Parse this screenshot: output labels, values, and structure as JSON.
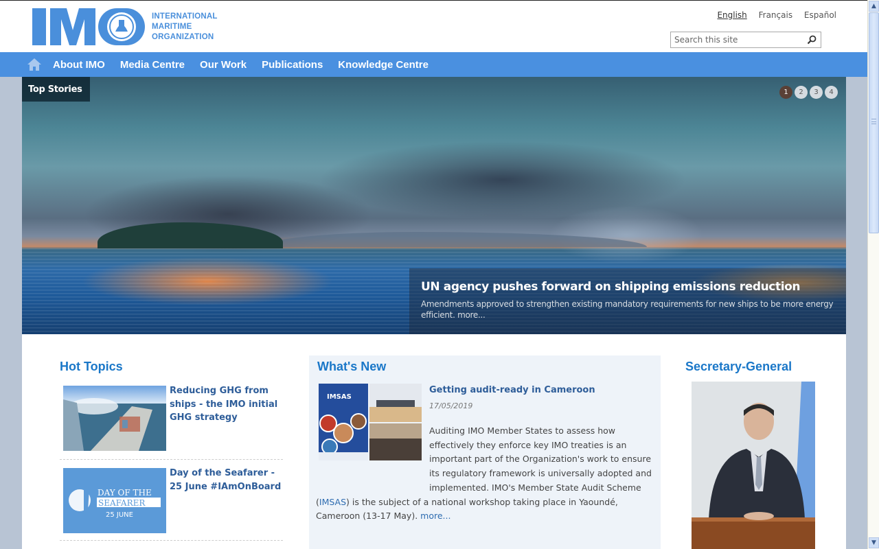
{
  "header": {
    "logo_text": "IMO",
    "org_name_lines": [
      "INTERNATIONAL",
      "MARITIME",
      "ORGANIZATION"
    ],
    "languages": [
      {
        "label": "English",
        "active": true
      },
      {
        "label": "Français",
        "active": false
      },
      {
        "label": "Español",
        "active": false
      }
    ],
    "search": {
      "placeholder": "Search this site",
      "value": "",
      "icon": "search-icon"
    },
    "brand_color": "#4a90e0"
  },
  "nav": {
    "home_icon": "home-icon",
    "items": [
      {
        "label": "About IMO"
      },
      {
        "label": "Media Centre"
      },
      {
        "label": "Our Work"
      },
      {
        "label": "Publications"
      },
      {
        "label": "Knowledge Centre"
      }
    ]
  },
  "hero": {
    "label": "Top Stories",
    "pager": [
      {
        "label": "1",
        "active": true
      },
      {
        "label": "2",
        "active": false
      },
      {
        "label": "3",
        "active": false
      },
      {
        "label": "4",
        "active": false
      }
    ],
    "title": "UN agency pushes forward on shipping emissions reduction",
    "description": "Amendments approved to strengthen existing mandatory requirements for new ships to be more energy efficient.",
    "more": "more..."
  },
  "hot_topics": {
    "title": "Hot Topics",
    "items": [
      {
        "title": "Reducing GHG from ships - the IMO initial GHG strategy",
        "image": "container-ship-photo"
      },
      {
        "title": "Day of the Seafarer - 25 June #IAmOnBoard",
        "image": "day-of-the-seafarer-banner",
        "image_text": [
          "DAY OF THE",
          "SEAFARER",
          "25 JUNE"
        ]
      }
    ]
  },
  "whats_new": {
    "title": "What's New",
    "item": {
      "title": "Getting audit-ready in Cameroon",
      "date": "17/05/2019",
      "image_text": "IMSAS",
      "body_before_link": "Auditing IMO Member States to assess how effectively they enforce key IMO treaties is an important part of the Organization's work to ensure its regulatory framework is universally adopted and implemented. IMO's Member State Audit Scheme (",
      "link": "IMSAS",
      "body_after_link": ") is the subject of a national workshop taking place in Yaoundé, Cameroon (13-17 May). ",
      "more": "more..."
    }
  },
  "secretary_general": {
    "title": "Secretary-General",
    "image": "secretary-general-portrait"
  }
}
